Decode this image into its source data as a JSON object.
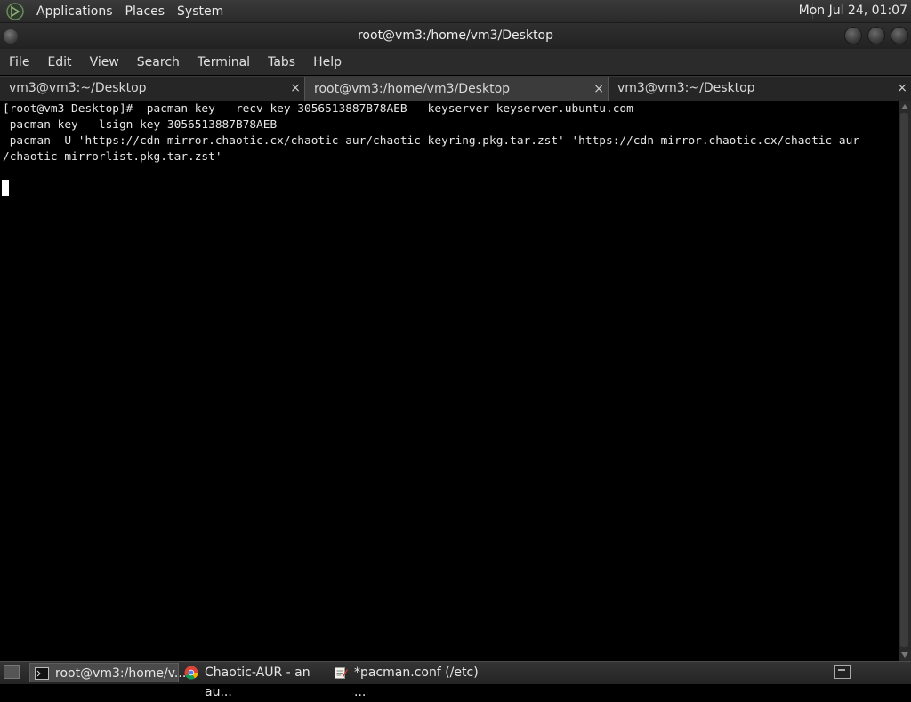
{
  "top_panel": {
    "menus": [
      "Applications",
      "Places",
      "System"
    ],
    "clock": "Mon Jul 24, 01:07"
  },
  "window": {
    "title": "root@vm3:/home/vm3/Desktop"
  },
  "menu_bar": {
    "items": [
      "File",
      "Edit",
      "View",
      "Search",
      "Terminal",
      "Tabs",
      "Help"
    ]
  },
  "tabs": [
    {
      "label": "vm3@vm3:~/Desktop",
      "active": false
    },
    {
      "label": "root@vm3:/home/vm3/Desktop",
      "active": true
    },
    {
      "label": "vm3@vm3:~/Desktop",
      "active": false
    }
  ],
  "tab_close_glyph": "×",
  "terminal": {
    "lines": [
      "[root@vm3 Desktop]#  pacman-key --recv-key 3056513887B78AEB --keyserver keyserver.ubuntu.com",
      " pacman-key --lsign-key 3056513887B78AEB",
      " pacman -U 'https://cdn-mirror.chaotic.cx/chaotic-aur/chaotic-keyring.pkg.tar.zst' 'https://cdn-mirror.chaotic.cx/chaotic-aur",
      "/chaotic-mirrorlist.pkg.tar.zst'"
    ]
  },
  "taskbar": {
    "tasks": [
      {
        "label": "root@vm3:/home/v...",
        "icon": "terminal-icon",
        "active": true
      },
      {
        "label": "Chaotic-AUR - an au...",
        "icon": "chrome-icon",
        "active": false
      },
      {
        "label": "*pacman.conf (/etc) ...",
        "icon": "text-editor-icon",
        "active": false
      }
    ]
  }
}
